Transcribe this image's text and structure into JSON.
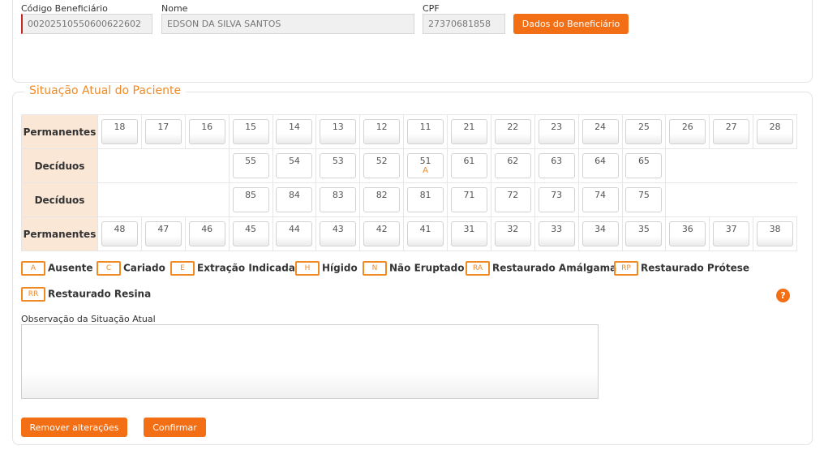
{
  "beneficiary": {
    "code_label": "Código Beneficiário",
    "code_value": "00202510550600622602",
    "name_label": "Nome",
    "name_value": "EDSON DA SILVA SANTOS",
    "cpf_label": "CPF",
    "cpf_value": "27370681858",
    "details_button": "Dados do Beneficiário"
  },
  "odontogram": {
    "section_title": "Situação Atual do Paciente",
    "rows": [
      {
        "label": "Permanentes",
        "offset": 0,
        "teeth": [
          {
            "n": "18",
            "c": ""
          },
          {
            "n": "17",
            "c": ""
          },
          {
            "n": "16",
            "c": ""
          },
          {
            "n": "15",
            "c": ""
          },
          {
            "n": "14",
            "c": ""
          },
          {
            "n": "13",
            "c": ""
          },
          {
            "n": "12",
            "c": ""
          },
          {
            "n": "11",
            "c": ""
          },
          {
            "n": "21",
            "c": ""
          },
          {
            "n": "22",
            "c": ""
          },
          {
            "n": "23",
            "c": ""
          },
          {
            "n": "24",
            "c": ""
          },
          {
            "n": "25",
            "c": ""
          },
          {
            "n": "26",
            "c": ""
          },
          {
            "n": "27",
            "c": ""
          },
          {
            "n": "28",
            "c": ""
          }
        ]
      },
      {
        "label": "Decíduos",
        "offset": 3,
        "teeth": [
          {
            "n": "55",
            "c": ""
          },
          {
            "n": "54",
            "c": ""
          },
          {
            "n": "53",
            "c": ""
          },
          {
            "n": "52",
            "c": ""
          },
          {
            "n": "51",
            "c": "A"
          },
          {
            "n": "61",
            "c": ""
          },
          {
            "n": "62",
            "c": ""
          },
          {
            "n": "63",
            "c": ""
          },
          {
            "n": "64",
            "c": ""
          },
          {
            "n": "65",
            "c": ""
          }
        ]
      },
      {
        "label": "Decíduos",
        "offset": 3,
        "teeth": [
          {
            "n": "85",
            "c": ""
          },
          {
            "n": "84",
            "c": ""
          },
          {
            "n": "83",
            "c": ""
          },
          {
            "n": "82",
            "c": ""
          },
          {
            "n": "81",
            "c": ""
          },
          {
            "n": "71",
            "c": ""
          },
          {
            "n": "72",
            "c": ""
          },
          {
            "n": "73",
            "c": ""
          },
          {
            "n": "74",
            "c": ""
          },
          {
            "n": "75",
            "c": ""
          }
        ]
      },
      {
        "label": "Permanentes",
        "offset": 0,
        "teeth": [
          {
            "n": "48",
            "c": ""
          },
          {
            "n": "47",
            "c": ""
          },
          {
            "n": "46",
            "c": ""
          },
          {
            "n": "45",
            "c": ""
          },
          {
            "n": "44",
            "c": ""
          },
          {
            "n": "43",
            "c": ""
          },
          {
            "n": "42",
            "c": ""
          },
          {
            "n": "41",
            "c": ""
          },
          {
            "n": "31",
            "c": ""
          },
          {
            "n": "32",
            "c": ""
          },
          {
            "n": "33",
            "c": ""
          },
          {
            "n": "34",
            "c": ""
          },
          {
            "n": "35",
            "c": ""
          },
          {
            "n": "36",
            "c": ""
          },
          {
            "n": "37",
            "c": ""
          },
          {
            "n": "38",
            "c": ""
          }
        ]
      }
    ]
  },
  "legend": [
    {
      "code": "A",
      "label": "Ausente"
    },
    {
      "code": "C",
      "label": "Cariado"
    },
    {
      "code": "E",
      "label": "Extração Indicada"
    },
    {
      "code": "H",
      "label": "Hígido"
    },
    {
      "code": "N",
      "label": "Não Eruptado"
    },
    {
      "code": "RA",
      "label": "Restaurado Amálgama"
    },
    {
      "code": "RP",
      "label": "Restaurado Prótese"
    },
    {
      "code": "RR",
      "label": "Restaurado Resina"
    }
  ],
  "help_icon": "?",
  "observation": {
    "label": "Observação da Situação Atual",
    "value": ""
  },
  "actions": {
    "remove_label": "Remover alterações",
    "confirm_label": "Confirmar"
  },
  "colors": {
    "accent": "#f36f16",
    "accent_text": "#f08a24",
    "row_label_bg": "#fbe7d6",
    "required_marker": "#c62828"
  }
}
